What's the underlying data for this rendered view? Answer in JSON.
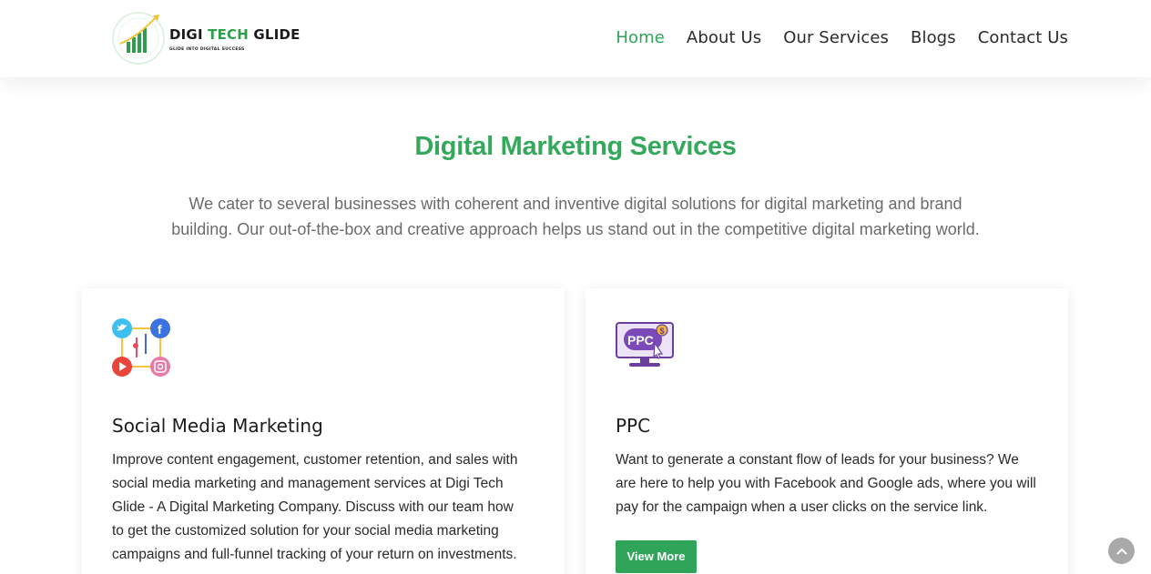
{
  "header": {
    "logo": {
      "name_part1": "DIGI ",
      "name_part2": "TECH ",
      "name_part3": "GLIDE",
      "tagline": "GLIDE INTO DIGITAL SUCCESS"
    },
    "nav": [
      {
        "label": "Home",
        "active": true
      },
      {
        "label": "About Us",
        "active": false
      },
      {
        "label": "Our Services",
        "active": false
      },
      {
        "label": "Blogs",
        "active": false
      },
      {
        "label": "Contact Us",
        "active": false
      }
    ]
  },
  "section": {
    "title": "Digital Marketing Services",
    "description_line1": "We cater to several businesses with coherent and inventive digital solutions for digital marketing and brand",
    "description_line2": "building. Our out-of-the-box and creative approach helps us stand out in the competitive digital marketing world."
  },
  "cards": [
    {
      "icon": "social-media-icon",
      "title": "Social Media Marketing",
      "lines": [
        "Improve content engagement, customer retention, and sales with",
        "social media marketing and management services at Digi Tech",
        "Glide - A Digital Marketing Company. Discuss with our team how",
        "to get the customized solution for your social media marketing",
        "campaigns and full-funnel tracking of your return on investments."
      ]
    },
    {
      "icon": "ppc-monitor-icon",
      "icon_text": "PPC",
      "title": "PPC",
      "lines": [
        "Want to generate a constant flow of leads for your business? We",
        "are here to help you with Facebook and Google ads, where you will",
        "pay for the campaign when a user clicks on the service link."
      ],
      "button_label": "View More"
    }
  ],
  "colors": {
    "brand_green": "#2fa55a",
    "title_green": "#34a95b",
    "text_gray": "#6b6b6b"
  },
  "scroll_top_icon": "chevron-up-icon"
}
